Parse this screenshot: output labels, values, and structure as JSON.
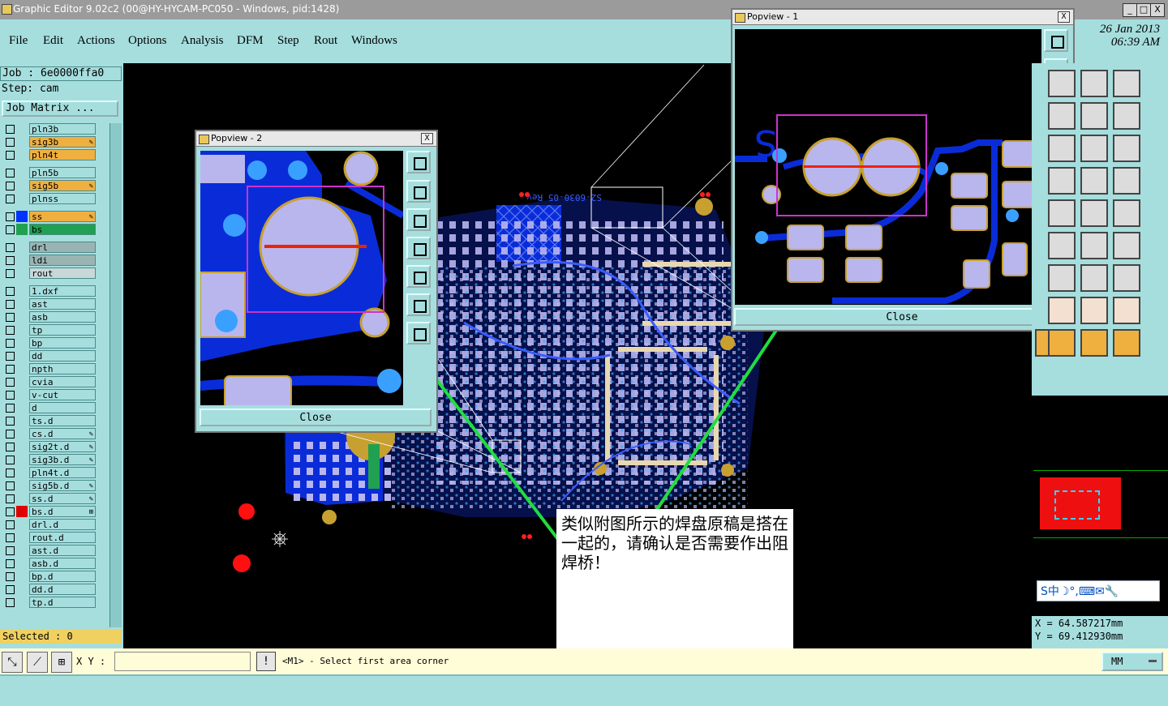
{
  "window": {
    "title": "Graphic Editor 9.02c2 (00@HY-HYCAM-PC050 - Windows, pid:1428)",
    "min": "_",
    "max": "□",
    "close": "X"
  },
  "menu": {
    "items": [
      "File",
      "Edit",
      "Actions",
      "Options",
      "Analysis",
      "DFM",
      "Step",
      "Rout",
      "Windows"
    ]
  },
  "datetime": {
    "date": "26 Jan 2013",
    "time": "06:39 AM"
  },
  "job": {
    "job_line": "Job : 6e0000ffa0",
    "step_line": "Step: cam",
    "matrix_button": "Job Matrix ...",
    "selected": "Selected : 0"
  },
  "layers": [
    {
      "name": "pln3b",
      "color": "#a6dede",
      "edit": ""
    },
    {
      "name": "sig3b",
      "color": "#f0b040",
      "edit": "✎"
    },
    {
      "name": "pln4t",
      "color": "#f0b040",
      "edit": ""
    },
    {
      "name": "pln5b",
      "color": "#a6dede",
      "edit": ""
    },
    {
      "name": "sig5b",
      "color": "#f0b040",
      "edit": "✎"
    },
    {
      "name": "plnss",
      "color": "#a6dede",
      "edit": ""
    },
    {
      "name": "ss",
      "color": "#f0b040",
      "edit": "✎",
      "swatch": "#0033ff"
    },
    {
      "name": "bs",
      "color": "#20a050",
      "edit": "",
      "swatch": "#20a050"
    },
    {
      "name": "drl",
      "color": "#9ab4b4",
      "edit": ""
    },
    {
      "name": "ldi",
      "color": "#9ab4b4",
      "edit": ""
    },
    {
      "name": "rout",
      "color": "#c8d8d8",
      "edit": ""
    },
    {
      "name": "1.dxf",
      "color": "#a6dede",
      "edit": ""
    },
    {
      "name": "ast",
      "color": "#a6dede",
      "edit": ""
    },
    {
      "name": "asb",
      "color": "#a6dede",
      "edit": ""
    },
    {
      "name": "tp",
      "color": "#a6dede",
      "edit": ""
    },
    {
      "name": "bp",
      "color": "#a6dede",
      "edit": ""
    },
    {
      "name": "dd",
      "color": "#a6dede",
      "edit": ""
    },
    {
      "name": "npth",
      "color": "#a6dede",
      "edit": ""
    },
    {
      "name": "cvia",
      "color": "#a6dede",
      "edit": ""
    },
    {
      "name": "v-cut",
      "color": "#a6dede",
      "edit": ""
    },
    {
      "name": "d",
      "color": "#a6dede",
      "edit": ""
    },
    {
      "name": "ts.d",
      "color": "#a6dede",
      "edit": ""
    },
    {
      "name": "cs.d",
      "color": "#a6dede",
      "edit": "✎"
    },
    {
      "name": "sig2t.d",
      "color": "#a6dede",
      "edit": "✎"
    },
    {
      "name": "sig3b.d",
      "color": "#a6dede",
      "edit": "✎"
    },
    {
      "name": "pln4t.d",
      "color": "#a6dede",
      "edit": ""
    },
    {
      "name": "sig5b.d",
      "color": "#a6dede",
      "edit": "✎"
    },
    {
      "name": "ss.d",
      "color": "#a6dede",
      "edit": "✎"
    },
    {
      "name": "bs.d",
      "color": "#a6dede",
      "edit": "⊞",
      "swatch": "#e00000"
    },
    {
      "name": "drl.d",
      "color": "#a6dede",
      "edit": ""
    },
    {
      "name": "rout.d",
      "color": "#a6dede",
      "edit": ""
    },
    {
      "name": "ast.d",
      "color": "#a6dede",
      "edit": ""
    },
    {
      "name": "asb.d",
      "color": "#a6dede",
      "edit": ""
    },
    {
      "name": "bp.d",
      "color": "#a6dede",
      "edit": ""
    },
    {
      "name": "dd.d",
      "color": "#a6dede",
      "edit": ""
    },
    {
      "name": "tp.d",
      "color": "#a6dede",
      "edit": ""
    }
  ],
  "popview1": {
    "title": "Popview - 1",
    "close_label": "Close",
    "close_x": "X"
  },
  "popview2": {
    "title": "Popview - 2",
    "close_label": "Close",
    "close_x": "X"
  },
  "annotation": {
    "text": "类似附图所示的焊盘原稿是搭在一起的，请确认是否需要作出阻焊桥！"
  },
  "bottom": {
    "xy_label": "X Y :",
    "xy_value": "",
    "prompt": "<M1> - Select first area corner",
    "units": "MM",
    "alert": "!"
  },
  "coords": {
    "x": "X  =  64.587217mm",
    "y": "Y  =  69.412930mm"
  },
  "ime": {
    "text": "S中☽°,⌨✉🔧"
  },
  "canvas": {
    "board_text": "S2-6030-05 Rev"
  },
  "colors": {
    "panel": "#a6dede",
    "trace": "#0a2cd8",
    "pad": "#b9b6ee",
    "gold": "#c8a030",
    "highlight": "#cc33cc",
    "marker": "#20dd40",
    "cut": "#ff2200"
  }
}
